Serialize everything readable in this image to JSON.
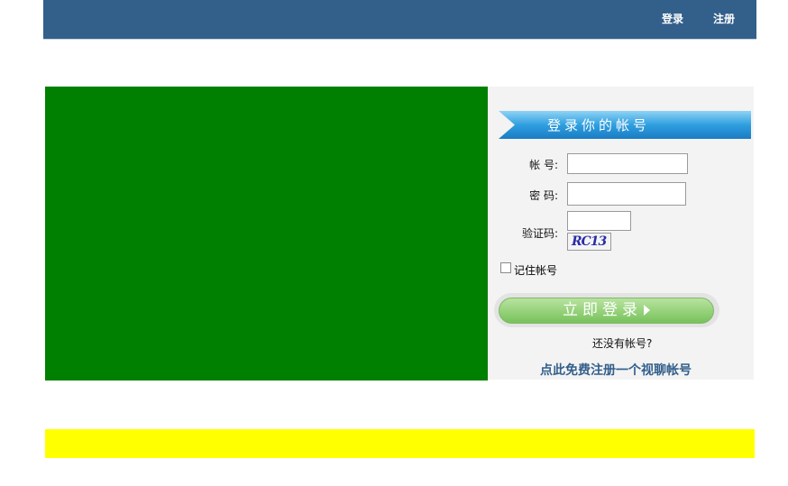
{
  "header": {
    "login_label": "登录",
    "register_label": "注册",
    "bar_color": "#335f8b"
  },
  "banner": {
    "color": "#008000"
  },
  "login_panel": {
    "title": "登录你的帐号",
    "account_label": "帐 号:",
    "account_value": "",
    "password_label": "密 码:",
    "password_value": "",
    "captcha_label": "验证码:",
    "captcha_value": "",
    "captcha_image_text": "RC13",
    "remember_label": "记住帐号",
    "remember_checked": false,
    "submit_label": "立即登录",
    "no_account_text": "还没有帐号?",
    "register_link": "点此免费注册一个视聊帐号"
  },
  "footer_bar": {
    "color": "#ffff00"
  }
}
